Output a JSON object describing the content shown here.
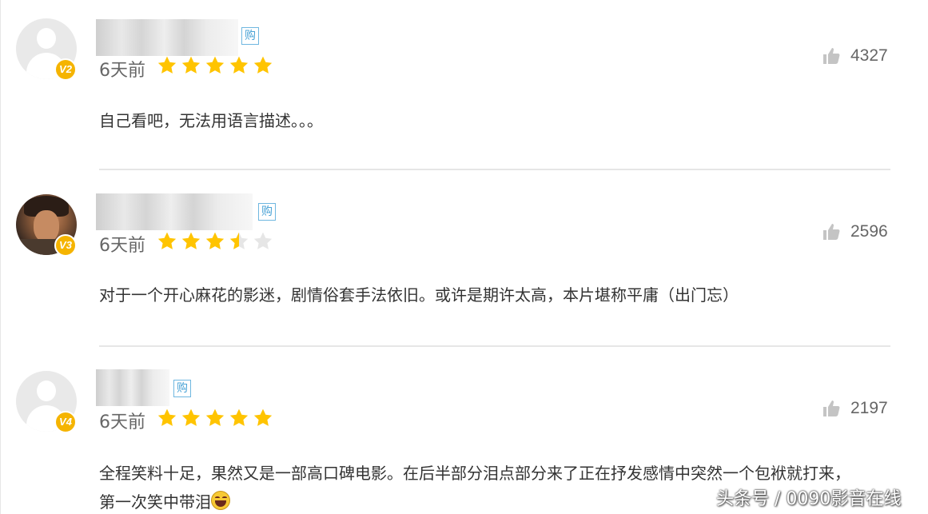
{
  "comments": [
    {
      "level": "V2",
      "buy_tag": "购",
      "time": "6天前",
      "rating": 5,
      "likes": "4327",
      "text": "自己看吧，无法用语言描述。。。",
      "avatar": "default-avatar-icon"
    },
    {
      "level": "V3",
      "buy_tag": "购",
      "time": "6天前",
      "rating": 3.5,
      "likes": "2596",
      "text": "对于一个开心麻花的影迷，剧情俗套手法依旧。或许是期许太高，本片堪称平庸（出门忘）",
      "avatar": "photo-avatar"
    },
    {
      "level": "V4",
      "buy_tag": "购",
      "time": "6天前",
      "rating": 5,
      "likes": "2197",
      "text_line1": "全程笑料十足，果然又是一部高口碑电影。在后半部分泪点部分来了正在抒发感情中突然一个包袱就打来，",
      "text_line2": "第一次笑中带泪",
      "avatar": "default-avatar-icon",
      "emoji": "laughing-tears-emoji-icon"
    }
  ],
  "colors": {
    "star": "#ffc400",
    "star_empty": "#e6e6e6",
    "badge": "#f5b400",
    "buy_tag": "#4aa3d6"
  },
  "watermark": "头条号 / 0090影音在线"
}
